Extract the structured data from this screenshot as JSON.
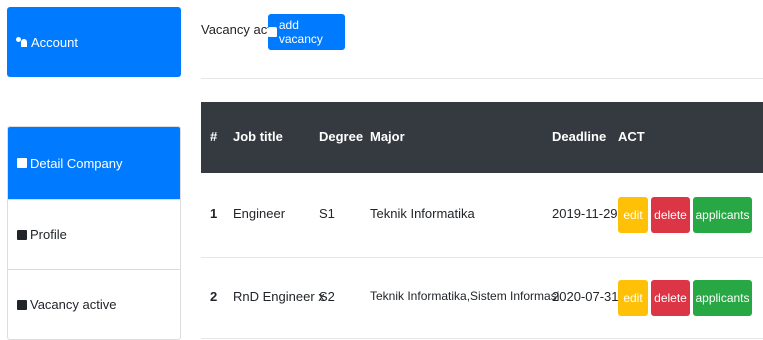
{
  "sidebar": {
    "account": {
      "label": "Account"
    },
    "items": [
      {
        "label": "Detail Company",
        "active": true
      },
      {
        "label": "Profile",
        "active": false
      },
      {
        "label": "Vacancy active",
        "active": false
      }
    ]
  },
  "header": {
    "title": "Vacancy active",
    "add_button": "add vacancy"
  },
  "table": {
    "columns": [
      "#",
      "Job title",
      "Degree",
      "Major",
      "Deadline",
      "ACT"
    ],
    "rows": [
      {
        "num": "1",
        "title": "Engineer",
        "degree": "S1",
        "major": "Teknik Informatika",
        "deadline": "2019-11-29"
      },
      {
        "num": "2",
        "title": "RnD Engineer x",
        "degree": "S2",
        "major": "Teknik Informatika,Sistem Informasi",
        "deadline": "2020-07-31"
      }
    ],
    "actions": {
      "edit": "edit",
      "delete": "delete",
      "applicants": "applicants"
    }
  },
  "colors": {
    "primary": "#007bff",
    "dark": "#343a40",
    "warning": "#ffc107",
    "danger": "#dc3545",
    "success": "#28a745"
  }
}
